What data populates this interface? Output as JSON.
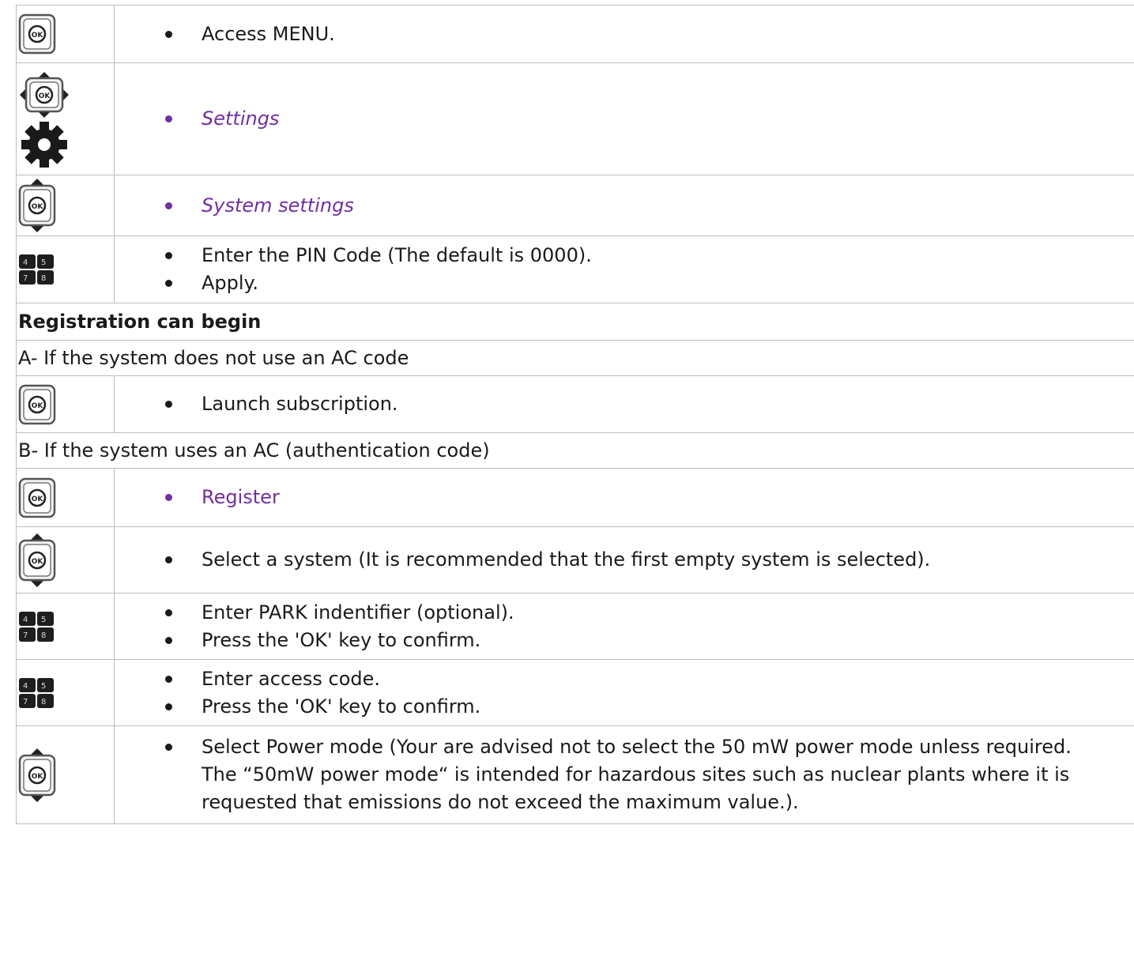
{
  "steps": [
    {
      "icons": [
        "ok-key-icon"
      ],
      "items": [
        "Access MENU."
      ]
    },
    {
      "icons": [
        "navigator-icon",
        "gear-icon"
      ],
      "items": [
        "Settings"
      ]
    },
    {
      "icons": [
        "nav-up-down-icon"
      ],
      "items": [
        "System settings"
      ]
    },
    {
      "icons": [
        "keypad-icon"
      ],
      "items": [
        "Enter the PIN Code (The default is 0000).",
        "Apply."
      ]
    },
    {
      "heading": "Registration can begin"
    },
    {
      "subheading": "A- If the system does not use an AC code"
    },
    {
      "icons": [
        "ok-key-icon"
      ],
      "items": [
        "Launch subscription."
      ]
    },
    {
      "subheading": "B- If the system uses an AC (authentication code)"
    },
    {
      "icons": [
        "ok-key-icon"
      ],
      "items": [
        "Register"
      ]
    },
    {
      "icons": [
        "nav-up-down-icon"
      ],
      "items": [
        "Select a system (It is recommended that the first empty system is selected)."
      ]
    },
    {
      "icons": [
        "keypad-icon"
      ],
      "items": [
        "Enter PARK indentifier (optional).",
        "Press the 'OK' key to confirm."
      ]
    },
    {
      "icons": [
        "keypad-icon"
      ],
      "items": [
        "Enter access code.",
        "Press the 'OK' key to confirm."
      ]
    },
    {
      "icons": [
        "nav-up-down-icon"
      ],
      "items": [
        "Select Power mode (Your are advised not to select the 50 mW power mode unless required. The “50mW power mode“ is intended for hazardous sites such as nuclear plants where it is requested that emissions do not exceed the maximum value.)."
      ]
    }
  ],
  "keypad_keys": [
    "4",
    "5",
    "7",
    "8"
  ],
  "ok_label": "OK",
  "colors": {
    "menu_item": "#7030a0",
    "text": "#1a1a1a",
    "border": "#bdbdbd"
  }
}
